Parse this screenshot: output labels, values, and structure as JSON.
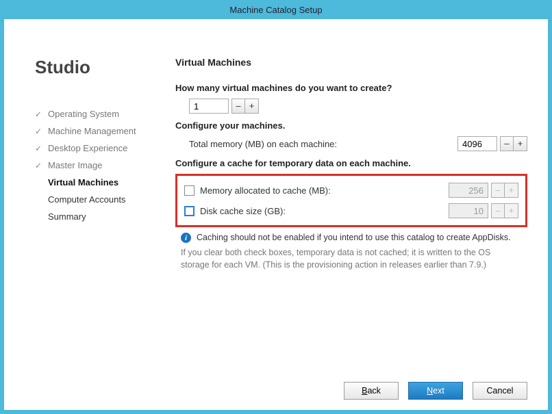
{
  "window": {
    "title": "Machine Catalog Setup"
  },
  "sidebar": {
    "app_name": "Studio",
    "items": [
      {
        "label": "Operating System",
        "state": "done"
      },
      {
        "label": "Machine Management",
        "state": "done"
      },
      {
        "label": "Desktop Experience",
        "state": "done"
      },
      {
        "label": "Master Image",
        "state": "done"
      },
      {
        "label": "Virtual Machines",
        "state": "active"
      },
      {
        "label": "Computer Accounts",
        "state": "future"
      },
      {
        "label": "Summary",
        "state": "future"
      }
    ]
  },
  "main": {
    "heading": "Virtual Machines",
    "vm_count": {
      "question": "How many virtual machines do you want to create?",
      "value": "1"
    },
    "configure": {
      "heading": "Configure your machines.",
      "memory_label": "Total memory (MB) on each machine:",
      "memory_value": "4096"
    },
    "cache": {
      "heading": "Configure a cache for temporary data on each machine.",
      "memory_checkbox_label": "Memory allocated to cache (MB):",
      "memory_value": "256",
      "disk_checkbox_label": "Disk cache size (GB):",
      "disk_value": "10",
      "info": "Caching should not be enabled if you intend to use this catalog to create AppDisks.",
      "note": "If you clear both check boxes, temporary data is not cached; it is written to the OS storage for each VM. (This is the provisioning action in releases earlier than 7.9.)"
    }
  },
  "footer": {
    "back": "Back",
    "next": "Next",
    "cancel": "Cancel"
  },
  "glyphs": {
    "minus": "–",
    "plus": "+",
    "check": "✓",
    "info": "i"
  }
}
